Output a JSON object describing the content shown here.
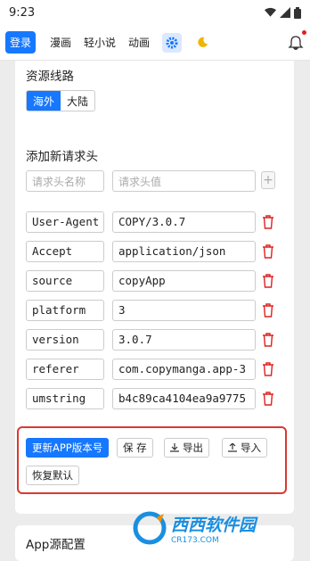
{
  "status": {
    "time": "9:23"
  },
  "nav": {
    "tabs": [
      "登录",
      "漫画",
      "轻小说",
      "动画"
    ]
  },
  "source_route": {
    "title": "资源线路",
    "options": [
      "海外",
      "大陆"
    ],
    "selected": "海外"
  },
  "headers": {
    "title": "添加新请求头",
    "name_placeholder": "请求头名称",
    "value_placeholder": "请求头值",
    "add_label": "+",
    "rows": [
      {
        "name": "User-Agent",
        "value": "COPY/3.0.7"
      },
      {
        "name": "Accept",
        "value": "application/json"
      },
      {
        "name": "source",
        "value": "copyApp"
      },
      {
        "name": "platform",
        "value": "3"
      },
      {
        "name": "version",
        "value": "3.0.7"
      },
      {
        "name": "referer",
        "value": "com.copymanga.app-3"
      },
      {
        "name": "umstring",
        "value": "b4c89ca4104ea9a9775"
      }
    ]
  },
  "actions": {
    "update_version": "更新APP版本号",
    "save": "保 存",
    "export": "导出",
    "import": "导入",
    "reset": "恢复默认"
  },
  "app_config": {
    "title": "App源配置"
  },
  "watermark": {
    "brand": "西西软件园",
    "site": "CR173.COM"
  },
  "colors": {
    "accent": "#1677ff",
    "delete": "#e02020",
    "highlight": "#d9392f"
  }
}
